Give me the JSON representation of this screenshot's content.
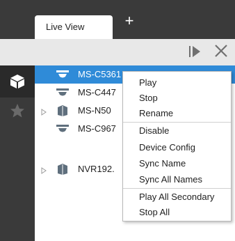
{
  "tabs": {
    "active_label": "Live View",
    "add_label": "+"
  },
  "toolbar": {
    "play_icon": "play-panel-icon",
    "close_icon": "close-icon"
  },
  "sidebar": {
    "items": [
      {
        "icon": "device-cube-icon"
      },
      {
        "icon": "star-icon"
      }
    ]
  },
  "tree": {
    "items": [
      {
        "label": "MS-C5361",
        "type": "dome-camera",
        "selected": true
      },
      {
        "label": "MS-C447",
        "type": "dome-camera"
      },
      {
        "label": "MS-N50",
        "type": "nvr",
        "expandable": true
      },
      {
        "label": "MS-C967",
        "type": "dome-camera"
      },
      {
        "label": "NVR192.",
        "type": "nvr",
        "expandable": true
      }
    ]
  },
  "context_menu": {
    "items": [
      "Play",
      "Stop",
      "Rename",
      "Disable",
      "Device Config",
      "Sync Name",
      "Sync All Names",
      "Play All Secondary",
      "Stop All"
    ]
  },
  "colors": {
    "selection": "#2f8bd8",
    "dark_bar": "#3a3a3a",
    "toolbar": "#e8e8e8"
  }
}
